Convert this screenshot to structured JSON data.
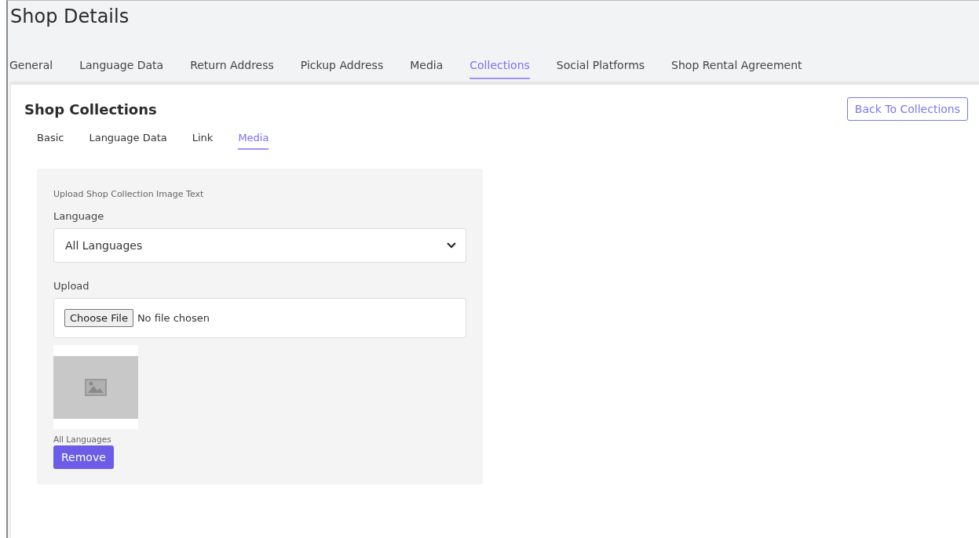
{
  "page": {
    "title": "Shop Details"
  },
  "tabs": [
    {
      "label": "General",
      "selected": false
    },
    {
      "label": "Language Data",
      "selected": false
    },
    {
      "label": "Return Address",
      "selected": false
    },
    {
      "label": "Pickup Address",
      "selected": false
    },
    {
      "label": "Media",
      "selected": false
    },
    {
      "label": "Collections",
      "selected": true
    },
    {
      "label": "Social Platforms",
      "selected": false
    },
    {
      "label": "Shop Rental Agreement",
      "selected": false
    }
  ],
  "card": {
    "title": "Shop Collections",
    "back_button": "Back To Collections",
    "subtabs": [
      {
        "label": "Basic",
        "selected": false
      },
      {
        "label": "Language Data",
        "selected": false
      },
      {
        "label": "Link",
        "selected": false
      },
      {
        "label": "Media",
        "selected": true
      }
    ],
    "form": {
      "heading": "Upload Shop Collection Image Text",
      "language_label": "Language",
      "language_value": "All Languages",
      "upload_label": "Upload",
      "file_button": "Choose File",
      "file_status": "No file chosen",
      "image_caption": "All Languages",
      "remove_button": "Remove"
    }
  }
}
